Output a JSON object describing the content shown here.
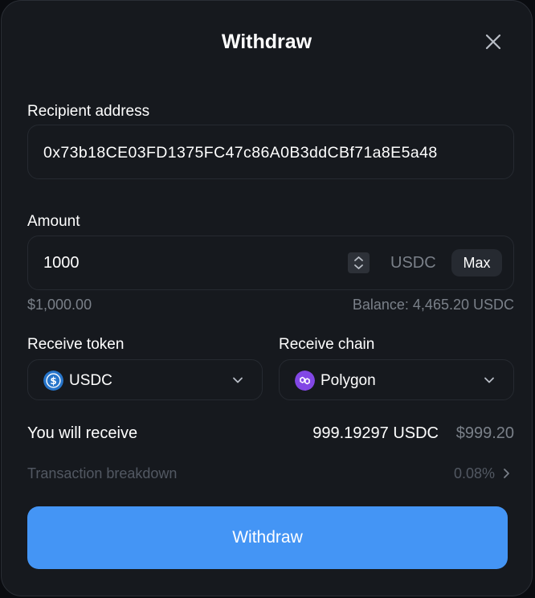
{
  "modal": {
    "title": "Withdraw"
  },
  "recipient": {
    "label": "Recipient address",
    "value": "0x73b18CE03FD1375FC47c86A0B3ddCBf71a8E5a48"
  },
  "amount": {
    "label": "Amount",
    "value": "1000",
    "unit": "USDC",
    "max_label": "Max",
    "usd_value": "$1,000.00",
    "balance": "Balance: 4,465.20 USDC"
  },
  "receive_token": {
    "label": "Receive token",
    "value": "USDC",
    "icon": "usdc-icon",
    "icon_color": "#2775ca"
  },
  "receive_chain": {
    "label": "Receive chain",
    "value": "Polygon",
    "icon": "polygon-icon",
    "icon_color": "#8247e5"
  },
  "summary": {
    "receive_label": "You will receive",
    "receive_amount": "999.19297 USDC",
    "receive_usd": "$999.20",
    "breakdown_label": "Transaction breakdown",
    "breakdown_pct": "0.08%"
  },
  "actions": {
    "withdraw_label": "Withdraw"
  },
  "colors": {
    "background": "#16191e",
    "accent": "#4495f5",
    "muted_text": "#7a8089"
  }
}
